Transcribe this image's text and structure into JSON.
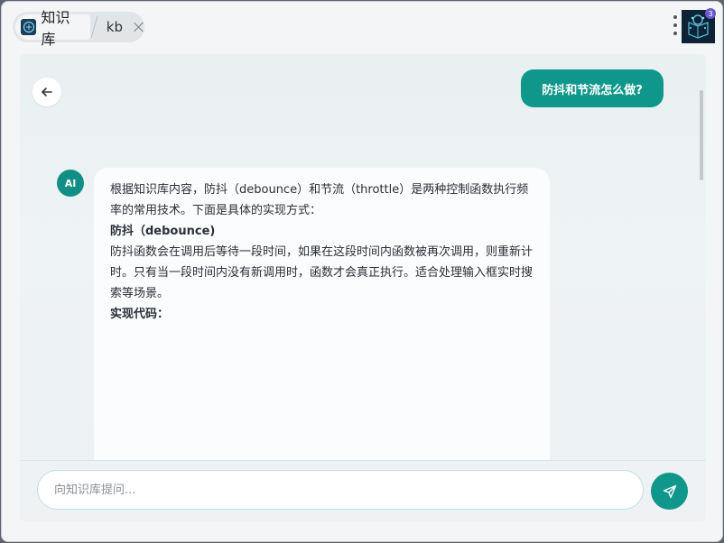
{
  "tabs": {
    "app_label": "知识库",
    "kb_label": "kb",
    "app_icon": "brain-book-icon",
    "close_icon": "close-icon"
  },
  "header": {
    "menu_icon": "vertical-ellipsis-icon",
    "profile_badge": "3",
    "profile_icon": "app-logo-icon"
  },
  "chat": {
    "back_icon": "arrow-left-icon",
    "user_message": "防抖和节流怎么做?",
    "ai_avatar_label": "AI",
    "ai_message": {
      "intro": "根据知识库内容，防抖（debounce）和节流（throttle）是两种控制函数执行频率的常用技术。下面是具体的实现方式：",
      "heading_debounce": "防抖（debounce)",
      "debounce_desc": "防抖函数会在调用后等待一段时间，如果在这段时间内函数被再次调用，则重新计时。只有当一段时间内没有新调用时，函数才会真正执行。适合处理输入框实时搜索等场景。",
      "heading_code": "实现代码："
    }
  },
  "composer": {
    "placeholder": "向知识库提问...",
    "value": "",
    "send_icon": "send-icon"
  },
  "colors": {
    "accent": "#10978b",
    "panel_bg": "#ecf1f4",
    "bubble_bg": "#fbfcfd"
  }
}
